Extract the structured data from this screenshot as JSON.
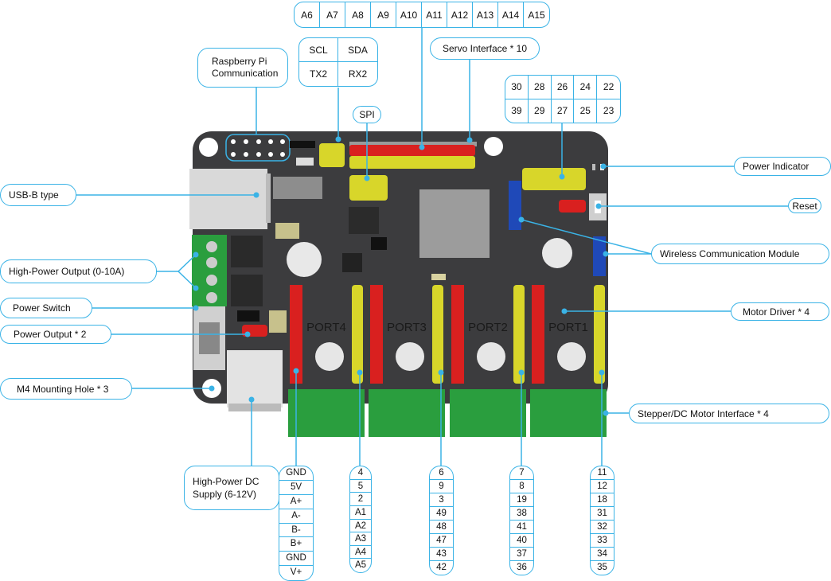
{
  "analog_header": [
    "A6",
    "A7",
    "A8",
    "A9",
    "A10",
    "A11",
    "A12",
    "A13",
    "A14",
    "A15"
  ],
  "i2c_uart": [
    [
      "SCL",
      "SDA"
    ],
    [
      "TX2",
      "RX2"
    ]
  ],
  "servo_pins": [
    [
      "30",
      "28",
      "26",
      "24",
      "22"
    ],
    [
      "39",
      "29",
      "27",
      "25",
      "23"
    ]
  ],
  "callouts": {
    "raspberry_pi": "Raspberry Pi\nCommunication",
    "servo": "Servo Interface * 10",
    "spi": "SPI",
    "usb": "USB-B type",
    "high_power_output": "High-Power Output (0-10A)",
    "power_switch": "Power Switch",
    "power_output": "Power Output * 2",
    "mounting_hole": "M4 Mounting Hole * 3",
    "dc_supply": "High-Power DC\nSupply (6-12V)",
    "power_indicator": "Power Indicator",
    "reset": "Reset",
    "wireless": "Wireless Communication Module",
    "motor_driver": "Motor Driver * 4",
    "stepper_interface": "Stepper/DC Motor Interface * 4"
  },
  "ports": [
    "PORT4",
    "PORT3",
    "PORT2",
    "PORT1"
  ],
  "pin_lists": {
    "motor_connector": [
      "GND",
      "5V",
      "A+",
      "A-",
      "B-",
      "B+",
      "GND",
      "V+"
    ],
    "port4": [
      "4",
      "5",
      "2",
      "A1",
      "A2",
      "A3",
      "A4",
      "A5"
    ],
    "port3": [
      "6",
      "9",
      "3",
      "49",
      "48",
      "47",
      "43",
      "42"
    ],
    "port2": [
      "7",
      "8",
      "19",
      "38",
      "41",
      "40",
      "37",
      "36"
    ],
    "port1": [
      "11",
      "12",
      "18",
      "31",
      "32",
      "33",
      "34",
      "35"
    ]
  },
  "colors": {
    "callout_line": "#3ab3e6",
    "board": "#3c3c3e",
    "header_red": "#d9201f",
    "header_yellow": "#d8d62a",
    "header_blue": "#1f49b8",
    "terminal_green": "#2a9e3e"
  }
}
